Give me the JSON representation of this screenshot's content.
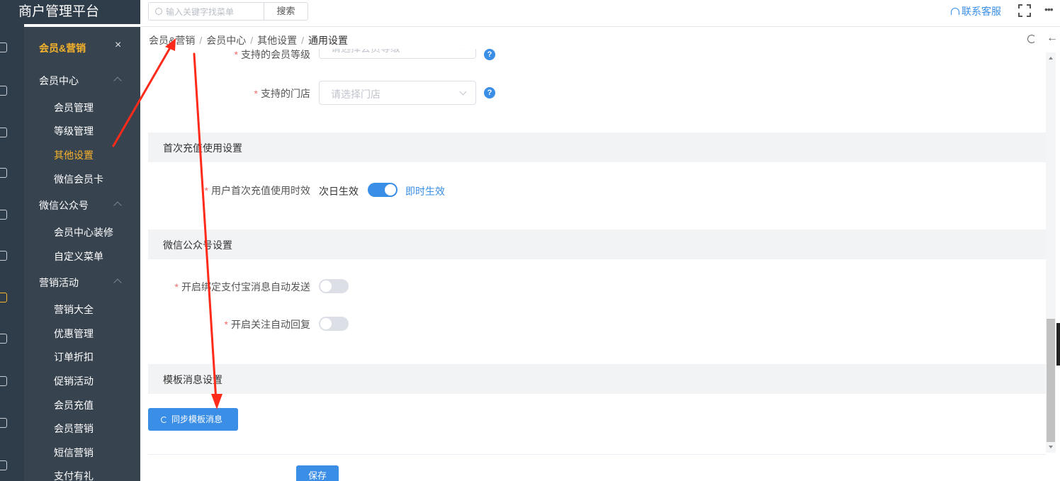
{
  "app": {
    "title": "商户管理平台"
  },
  "topbar": {
    "search_placeholder": "输入关键字找菜单",
    "search_button": "搜索",
    "contact": "联系客服",
    "more": "•••"
  },
  "subnav": {
    "section_title": "会员&营销",
    "close": "×",
    "groups": [
      {
        "label": "会员中心",
        "items": [
          "会员管理",
          "等级管理",
          "其他设置",
          "微信会员卡"
        ]
      },
      {
        "label": "微信公众号",
        "items": [
          "会员中心装修",
          "自定义菜单"
        ]
      },
      {
        "label": "营销活动",
        "items": [
          "营销大全",
          "优惠管理",
          "订单折扣",
          "促销活动",
          "会员充值",
          "会员营销",
          "短信营销",
          "支付有礼"
        ]
      }
    ],
    "active_item": "其他设置"
  },
  "breadcrumb": [
    "会员&营销",
    "会员中心",
    "其他设置",
    "通用设置"
  ],
  "form": {
    "partial_label": "支持的会员等级",
    "partial_placeholder": "请选择会员等级",
    "store_label": "支持的门店",
    "store_placeholder": "请选择门店",
    "help": "?",
    "section_first_recharge": "首次充值使用设置",
    "recharge_label": "用户首次充值使用时效",
    "recharge_off_text": "次日生效",
    "recharge_on_text": "即时生效",
    "recharge_enabled": true,
    "section_wechat": "微信公众号设置",
    "alipay_label": "开启绑定支付宝消息自动发送",
    "alipay_enabled": false,
    "follow_label": "开启关注自动回复",
    "follow_enabled": false,
    "section_template": "模板消息设置",
    "sync_button": "同步模板消息",
    "save_button": "保存"
  },
  "colors": {
    "accent": "#3a8ee6",
    "nav_active": "#f7b32b",
    "sidebar_bg": "#37434f",
    "annotation": "#ff2a1a"
  }
}
